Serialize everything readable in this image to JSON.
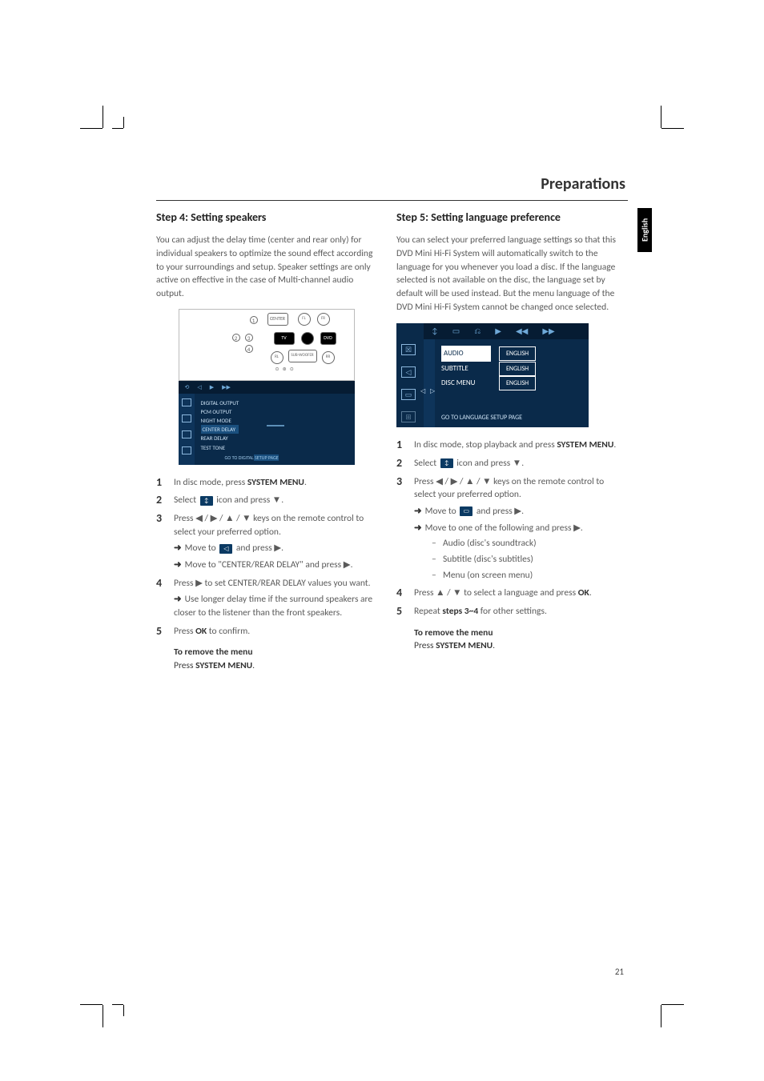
{
  "header": {
    "title": "Preparations",
    "language_tab": "English"
  },
  "page_number": "21",
  "left": {
    "title": "Step 4: Setting speakers",
    "intro": "You can adjust the delay time (center and rear only) for individual speakers to optimize the sound effect according to your surroundings and setup. Speaker settings are only active on effective in the case of  Multi-channel audio output.",
    "speaker_fig": {
      "labels": {
        "center": "CENTER",
        "fl": "FL",
        "fr": "FR",
        "rl": "RL",
        "rr": "RR",
        "sub": "SUB-WOOFER",
        "tv": "TV",
        "dvd": "DVD"
      },
      "callouts": [
        "1",
        "2",
        "3",
        "4"
      ]
    },
    "osd_fig": {
      "top_icons": [
        "⟲",
        "◁",
        "▶",
        "▶▶"
      ],
      "menu_items": [
        "DIGITAL OUTPUT",
        "PCM OUTPUT",
        "NIGHT MODE",
        "CENTER DELAY",
        "REAR DELAY",
        "TEST TONE"
      ],
      "highlight_index": 3,
      "value_box": "",
      "footer_prefix": "GO TO DIGITAL",
      "footer_suffix": " SETUP PAGE"
    },
    "steps": [
      {
        "num": "1",
        "text_pre": "In disc mode, press ",
        "bold": "SYSTEM MENU",
        "text_post": "."
      },
      {
        "num": "2",
        "text_pre": "Select ",
        "icon": "↕",
        "text_post": " icon and press ▼."
      },
      {
        "num": "3",
        "text_pre": "Press ◀ / ▶ / ▲ / ▼ keys on the remote control to select your preferred option.",
        "subs": [
          {
            "arrow": true,
            "pre": "Move to ",
            "icon": "◁",
            "post": " and press ▶."
          },
          {
            "arrow": true,
            "pre": "Move to \"CENTER/REAR DELAY\" and press ▶."
          }
        ]
      },
      {
        "num": "4",
        "text_pre": "Press ▶ to set CENTER/REAR DELAY values you want.",
        "subs": [
          {
            "arrow": true,
            "pre": "Use longer delay time if the surround speakers are closer to the listener than the front speakers."
          }
        ]
      },
      {
        "num": "5",
        "text_pre": "Press ",
        "bold": "OK",
        "text_post": " to confirm."
      }
    ],
    "remove": {
      "title": "To remove the menu",
      "line_pre": "Press ",
      "line_bold": "SYSTEM MENU",
      "line_post": "."
    }
  },
  "right": {
    "title": "Step 5: Setting language preference",
    "intro": "You can select your preferred language settings so that this DVD Mini Hi-Fi System will automatically switch to the language for you whenever you load a disc. If the language selected is not available on the disc, the language set by default will be used instead. But the menu language of the DVD Mini Hi-Fi System cannot be changed once selected.",
    "lang_fig": {
      "top_icons": [
        "↕",
        "▭",
        "⎌",
        "▶",
        "◀◀",
        "▶▶"
      ],
      "left_icons": [
        "☒",
        "◁",
        "▭",
        "⊞"
      ],
      "rows": [
        {
          "label": "AUDIO",
          "value": "ENGLISH",
          "highlight": true
        },
        {
          "label": "SUBTITLE",
          "value": "ENGLISH"
        },
        {
          "label": "DISC MENU",
          "value": "ENGLISH"
        }
      ],
      "footer": "GO TO LANGUAGE SETUP PAGE"
    },
    "steps": [
      {
        "num": "1",
        "text_pre": "In disc mode, stop playback and press ",
        "bold": "SYSTEM MENU",
        "text_post": "."
      },
      {
        "num": "2",
        "text_pre": "Select ",
        "icon": "↕",
        "text_post": " icon and press ▼."
      },
      {
        "num": "3",
        "text_pre": "Press ◀ / ▶ / ▲ / ▼ keys on the remote control to select your preferred option.",
        "subs": [
          {
            "arrow": true,
            "pre": "Move to ",
            "icon": "▭",
            "post": " and press ▶."
          },
          {
            "arrow": true,
            "pre": "Move to one of the following and press ▶."
          }
        ],
        "dashes": [
          "Audio (disc's soundtrack)",
          "Subtitle (disc's subtitles)",
          "Menu (on screen menu)"
        ]
      },
      {
        "num": "4",
        "text_pre": "Press ▲ / ▼ to select a language and press ",
        "bold": "OK",
        "text_post": "."
      },
      {
        "num": "5",
        "text_pre": "Repeat ",
        "bold": "steps 3~4",
        "text_post": " for other settings."
      }
    ],
    "remove": {
      "title": "To remove the menu",
      "line_pre": "Press ",
      "line_bold": "SYSTEM MENU",
      "line_post": "."
    }
  }
}
